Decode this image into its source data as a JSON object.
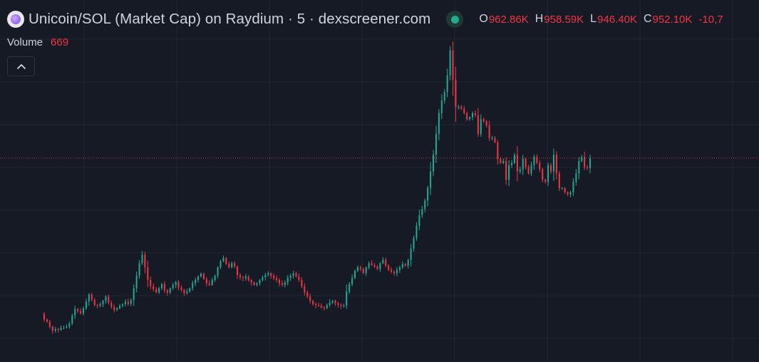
{
  "legend": {
    "title": "Unicoin/SOL (Market Cap) on Raydium · 5 · dexscreener.com",
    "open_label": "O",
    "open_value": "962.86K",
    "high_label": "H",
    "high_value": "958.59K",
    "low_label": "L",
    "low_value": "946.40K",
    "close_label": "C",
    "close_value": "952.10K",
    "change_value": "-10,7",
    "status_color": "#22ab94"
  },
  "volume": {
    "label": "Volume",
    "value": "669"
  },
  "colors": {
    "background": "#161a25",
    "grid": "#232733",
    "up": "#22ab94",
    "down": "#f23645",
    "price_line": "#f23645"
  },
  "icons": {
    "logo": "unicoin-logo-icon",
    "status": "live-status-icon",
    "collapse": "chevron-up-icon"
  },
  "chart_data": {
    "type": "candlestick",
    "x_unit": "5-minute bars",
    "current_price_line": 952.1,
    "x": [
      0,
      1,
      2,
      3,
      4,
      5,
      6,
      7,
      8,
      9,
      10,
      11,
      12,
      13,
      14,
      15,
      16,
      17,
      18,
      19,
      20,
      21,
      22,
      23,
      24,
      25,
      26,
      27,
      28,
      29,
      30,
      31,
      32,
      33,
      34,
      35,
      36,
      37,
      38,
      39,
      40,
      41,
      42,
      43,
      44,
      45,
      46,
      47,
      48,
      49,
      50,
      51,
      52,
      53,
      54,
      55,
      56,
      57,
      58,
      59,
      60,
      61,
      62,
      63,
      64,
      65,
      66,
      67,
      68,
      69,
      70,
      71,
      72,
      73,
      74,
      75,
      76,
      77,
      78,
      79,
      80,
      81,
      82,
      83,
      84,
      85,
      86,
      87,
      88,
      89,
      90,
      91,
      92,
      93,
      94,
      95,
      96,
      97,
      98,
      99,
      100,
      101,
      102,
      103,
      104,
      105,
      106,
      107,
      108,
      109,
      110,
      111,
      112,
      113,
      114,
      115,
      116,
      117,
      118,
      119,
      120,
      121,
      122,
      123,
      124,
      125,
      126,
      127,
      128,
      129,
      130,
      131,
      132,
      133,
      134,
      135,
      136,
      137,
      138,
      139,
      140,
      141,
      142,
      143,
      144,
      145,
      146,
      147,
      148,
      149,
      150,
      151,
      152,
      153,
      154,
      155,
      156,
      157,
      158,
      159,
      160,
      161,
      162,
      163,
      164,
      165,
      166,
      167,
      168,
      169,
      170,
      171,
      172,
      173,
      174,
      175,
      176,
      177,
      178,
      179,
      180,
      181,
      182,
      183,
      184,
      185,
      186,
      187,
      188,
      189,
      190,
      191,
      192,
      193,
      194,
      195,
      196,
      197,
      198,
      199,
      200,
      201,
      202,
      203,
      204,
      205,
      206,
      207,
      208,
      209,
      210,
      211,
      212,
      213,
      214,
      215,
      216,
      217,
      218,
      219,
      220,
      221,
      222,
      223,
      224,
      225,
      226,
      227,
      228,
      229,
      230,
      231,
      232,
      233,
      234,
      235,
      236,
      237,
      238
    ],
    "close": [
      565,
      560,
      548,
      538,
      542,
      540,
      545,
      546,
      548,
      555,
      575,
      590,
      585,
      580,
      592,
      608,
      625,
      612,
      600,
      598,
      602,
      610,
      620,
      605,
      595,
      588,
      592,
      598,
      602,
      608,
      602,
      612,
      640,
      670,
      700,
      720,
      690,
      660,
      645,
      638,
      630,
      640,
      650,
      635,
      630,
      640,
      648,
      655,
      642,
      636,
      628,
      632,
      640,
      652,
      660,
      668,
      675,
      662,
      652,
      648,
      660,
      670,
      690,
      705,
      712,
      698,
      690,
      700,
      692,
      672,
      666,
      664,
      668,
      660,
      654,
      648,
      652,
      660,
      666,
      672,
      676,
      670,
      664,
      660,
      652,
      648,
      654,
      665,
      670,
      676,
      668,
      660,
      645,
      630,
      620,
      610,
      602,
      600,
      598,
      594,
      592,
      600,
      606,
      610,
      604,
      600,
      598,
      598,
      632,
      650,
      665,
      682,
      690,
      686,
      676,
      690,
      700,
      696,
      692,
      686,
      700,
      708,
      694,
      684,
      680,
      676,
      684,
      690,
      698,
      694,
      708,
      735,
      760,
      790,
      815,
      830,
      850,
      880,
      920,
      960,
      1010,
      1060,
      1090,
      1110,
      1150,
      1210,
      1140,
      1075,
      1075,
      1070,
      1060,
      1045,
      1050,
      1060,
      1055,
      1010,
      1045,
      1040,
      1030,
      1000,
      1000,
      990,
      950,
      940,
      945,
      900,
      935,
      940,
      960,
      920,
      925,
      950,
      930,
      915,
      935,
      955,
      940,
      925,
      900,
      895,
      935,
      920,
      960,
      915,
      880,
      880,
      870,
      865,
      870,
      895,
      915,
      945,
      955,
      930,
      928,
      952
    ]
  }
}
